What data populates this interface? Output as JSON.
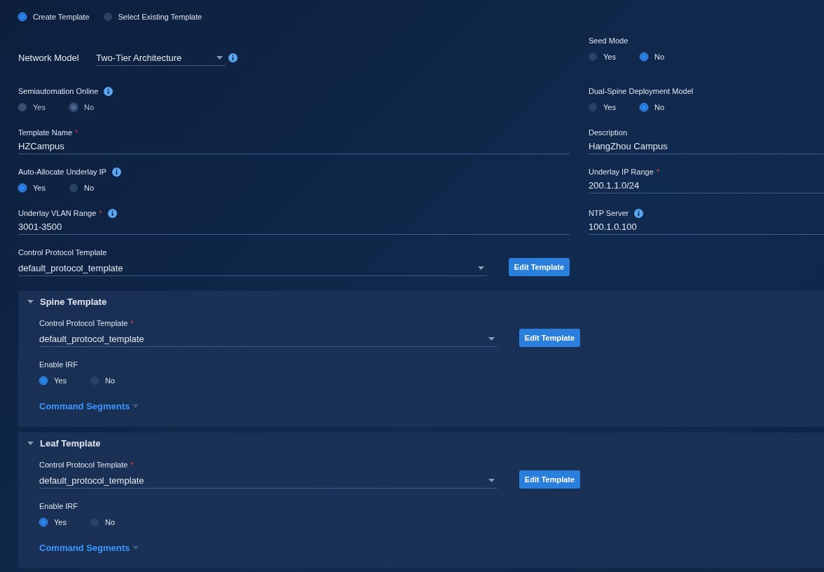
{
  "mode": [
    {
      "label": "Create Template",
      "selected": true
    },
    {
      "label": "Select Existing Template",
      "selected": false
    }
  ],
  "form": {
    "rows": [
      [
        {
          "kind": "inline-select",
          "label": "Network Model",
          "value": "Two-Tier Architecture",
          "info": true
        },
        {
          "kind": "radio",
          "label": "Seed Mode",
          "options": [
            {
              "label": "Yes",
              "selected": false
            },
            {
              "label": "No",
              "selected": true
            }
          ]
        }
      ],
      [
        {
          "kind": "radio",
          "label": "Semiautomation Online",
          "info": true,
          "disabled": true,
          "options": [
            {
              "label": "Yes",
              "selected": false
            },
            {
              "label": "No",
              "selected": true
            }
          ]
        },
        {
          "kind": "radio",
          "label": "Dual-Spine Deployment Model",
          "options": [
            {
              "label": "Yes",
              "selected": false
            },
            {
              "label": "No",
              "selected": true
            }
          ]
        }
      ],
      [
        {
          "kind": "text",
          "label": "Template Name",
          "required_mark": "*",
          "value": "HZCampus"
        },
        {
          "kind": "text",
          "label": "Description",
          "value": "HangZhou Campus"
        }
      ],
      [
        {
          "kind": "radio",
          "label": "Auto-Allocate Underlay IP",
          "info": true,
          "options": [
            {
              "label": "Yes",
              "selected": true
            },
            {
              "label": "No",
              "selected": false
            }
          ]
        },
        {
          "kind": "text",
          "label": "Underlay IP Range",
          "required_mark": "*",
          "value": "200.1.1.0/24"
        }
      ],
      [
        {
          "kind": "text",
          "label": "Underlay VLAN Range",
          "required_mark": "*",
          "info": true,
          "value": "3001-3500"
        },
        {
          "kind": "text",
          "label": "NTP Server",
          "info": true,
          "value": "100.1.0.100"
        }
      ],
      [
        {
          "kind": "select",
          "label": "Control Protocol Template",
          "value": "default_protocol_template",
          "button": "Edit Template"
        }
      ]
    ]
  },
  "sections": [
    {
      "title": "Spine Template",
      "expanded": true,
      "fields": [
        {
          "kind": "select",
          "label": "Control Protocol Template",
          "required_mark": "*",
          "value": "default_protocol_template",
          "button": "Edit Template"
        },
        {
          "kind": "radio",
          "label": "Enable IRF",
          "options": [
            {
              "label": "Yes",
              "selected": true
            },
            {
              "label": "No",
              "selected": false
            }
          ]
        }
      ],
      "link": "Command Segments"
    },
    {
      "title": "Leaf Template",
      "expanded": true,
      "fields": [
        {
          "kind": "select",
          "label": "Control Protocol Template",
          "required_mark": "*",
          "value": "default_protocol_template",
          "button": "Edit Template"
        },
        {
          "kind": "radio",
          "label": "Enable IRF",
          "options": [
            {
              "label": "Yes",
              "selected": true
            },
            {
              "label": "No",
              "selected": false
            }
          ]
        }
      ],
      "link": "Command Segments"
    }
  ]
}
